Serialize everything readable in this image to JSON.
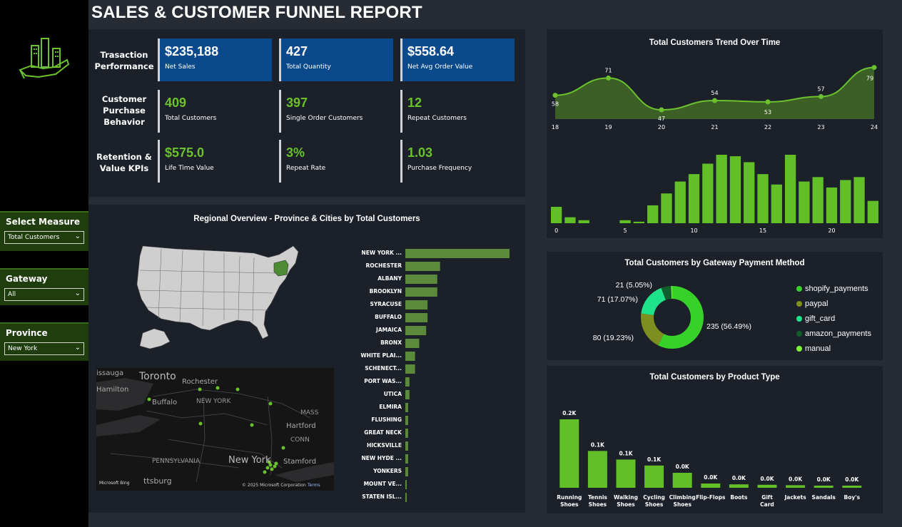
{
  "title": "SALES & CUSTOMER FUNNEL REPORT",
  "slicers": [
    {
      "label": "Select Measure",
      "value": "Total Customers"
    },
    {
      "label": "Gateway",
      "value": "All"
    },
    {
      "label": "Province",
      "value": "New York"
    }
  ],
  "kpi_rows": [
    {
      "label": "Trasaction Performance",
      "cards": [
        {
          "value": "$235,188",
          "caption": "Net Sales"
        },
        {
          "value": "427",
          "caption": "Total Quantity"
        },
        {
          "value": "$558.64",
          "caption": "Net Avg Order Value"
        }
      ]
    },
    {
      "label": "Customer Purchase Behavior",
      "cards": [
        {
          "value": "409",
          "caption": "Total Customers"
        },
        {
          "value": "397",
          "caption": "Single Order Customers"
        },
        {
          "value": "12",
          "caption": "Repeat Customers"
        }
      ]
    },
    {
      "label": "Retention & Value KPIs",
      "cards": [
        {
          "value": "$575.0",
          "caption": "Life Time Value"
        },
        {
          "value": "3%",
          "caption": "Repeat Rate"
        },
        {
          "value": "1.03",
          "caption": "Purchase Frequency"
        }
      ]
    }
  ],
  "regional": {
    "title": "Regional Overview - Province & Cities by Total Customers",
    "map_labels": {
      "cities": [
        "Toronto",
        "Rochester",
        "Buffalo",
        "Hamilton",
        "issauga",
        "ttsburg",
        "New York",
        "Stamford",
        "Hartford",
        "NEW YORK",
        "PENNSYLVANIA",
        "MASS",
        "CONN"
      ],
      "copyright": "© 2025 Microsoft Corporation",
      "terms": "Terms",
      "bing": "Microsoft Bing"
    }
  },
  "colors": {
    "accent_green": "#6bc12e",
    "kpi_blue": "#0a4a8c",
    "bar_green": "#62bf27",
    "city_bar": "#5b8a3c",
    "highlight_state": "#4c8a36",
    "panel": "#1c2129",
    "bg": "#262b34"
  },
  "trend_title": "Total Customers Trend Over Time",
  "gateway_title": "Total Customers by Gateway Payment Method",
  "product_title": "Total Customers by Product Type",
  "chart_data": [
    {
      "type": "bar",
      "orientation": "horizontal",
      "title": "",
      "categories": [
        "NEW YORK ...",
        "ROCHESTER",
        "ALBANY",
        "BROOKLYN",
        "SYRACUSE",
        "BUFFALO",
        "JAMAICA",
        "BRONX",
        "WHITE PLAI...",
        "SCHENECT...",
        "PORT WAS...",
        "UTICA",
        "ELMIRA",
        "FLUSHING",
        "GREAT NECK",
        "HICKSVILLE",
        "NEW HYDE ...",
        "YONKERS",
        "MOUNT VE...",
        "STATEN ISL..."
      ],
      "values": [
        75,
        25,
        23,
        23,
        16,
        16,
        15,
        10,
        7,
        7,
        3,
        3,
        2,
        2,
        2,
        2,
        2,
        2,
        1,
        1
      ]
    },
    {
      "type": "area",
      "title": "Total Customers Trend Over Time",
      "x": [
        18,
        19,
        20,
        21,
        22,
        23,
        24
      ],
      "values": [
        58,
        71,
        47,
        54,
        53,
        57,
        79
      ]
    },
    {
      "type": "bar",
      "title": "",
      "x": [
        0,
        1,
        2,
        3,
        4,
        5,
        6,
        7,
        8,
        9,
        10,
        11,
        12,
        13,
        14,
        15,
        16,
        17,
        18,
        19,
        20,
        21,
        22,
        23
      ],
      "xticks": [
        0,
        5,
        10,
        15,
        20
      ],
      "values": [
        11,
        4,
        2,
        0,
        0,
        2,
        1,
        12,
        20,
        28,
        33,
        40,
        46,
        45,
        41,
        33,
        26,
        46,
        28,
        31,
        24,
        29,
        31,
        15
      ]
    },
    {
      "type": "pie",
      "title": "Total Customers by Gateway Payment Method",
      "labels": [
        "shopify_payments",
        "paypal",
        "gift_card",
        "amazon_payments",
        "manual"
      ],
      "values": [
        235,
        80,
        71,
        21,
        3
      ],
      "data_labels": [
        "235 (56.49%)",
        "80 (19.23%)",
        "71 (17.07%)",
        "21 (5.05%)",
        ""
      ],
      "colors": [
        "#38d12a",
        "#7d8f1e",
        "#1fe38a",
        "#0f5e2c",
        "#7af53a"
      ],
      "legend": "right"
    },
    {
      "type": "bar",
      "title": "Total Customers by Product Type",
      "categories": [
        "Running Shoes",
        "Tennis Shoes",
        "Walking Shoes",
        "Cycling Shoes",
        "Climbing Shoes",
        "Flip-Flops",
        "Boots",
        "Gift Card",
        "Jackets",
        "Sandals",
        "Boy's"
      ],
      "values": [
        160,
        86,
        66,
        52,
        35,
        10,
        8,
        7,
        6,
        5,
        4
      ],
      "data_labels": [
        "0.2K",
        "0.1K",
        "0.1K",
        "0.1K",
        "0.0K",
        "0.0K",
        "0.0K",
        "0.0K",
        "0.0K",
        "0.0K",
        "0.0K"
      ]
    }
  ]
}
